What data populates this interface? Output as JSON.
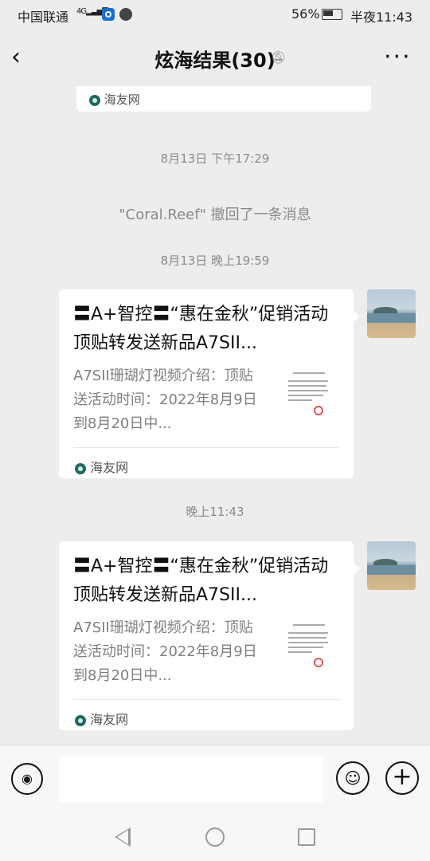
{
  "status_bar": {
    "carrier": "中国联通",
    "network": "4G",
    "battery": "56%",
    "time": "半夜11:43"
  },
  "header": {
    "title": "炫海结果(30)",
    "more": "···"
  },
  "top_card": {
    "source": "海友网"
  },
  "messages": [
    {
      "timestamp": "8月13日 下午17:29"
    },
    {
      "recall_text": "\"Coral.Reef\" 撤回了一条消息"
    },
    {
      "timestamp": "8月13日 晚上19:59"
    },
    {
      "title": "〓A+智控〓“惠在金秋”促销活动顶贴转发送新品A7SII...",
      "description": "A7SII珊瑚灯视频介绍：顶贴送活动时间：2022年8月9日到8月20日中...",
      "source": "海友网"
    },
    {
      "timestamp": "晚上11:43"
    },
    {
      "title": "〓A+智控〓“惠在金秋”促销活动顶贴转发送新品A7SII...",
      "description": "A7SII珊瑚灯视频介绍：顶贴送活动时间：2022年8月9日到8月20日中...",
      "source": "海友网"
    }
  ],
  "input_bar": {
    "voice_icon": "voice-icon",
    "emoji_icon": "emoji-icon",
    "plus_icon": "plus-icon"
  }
}
